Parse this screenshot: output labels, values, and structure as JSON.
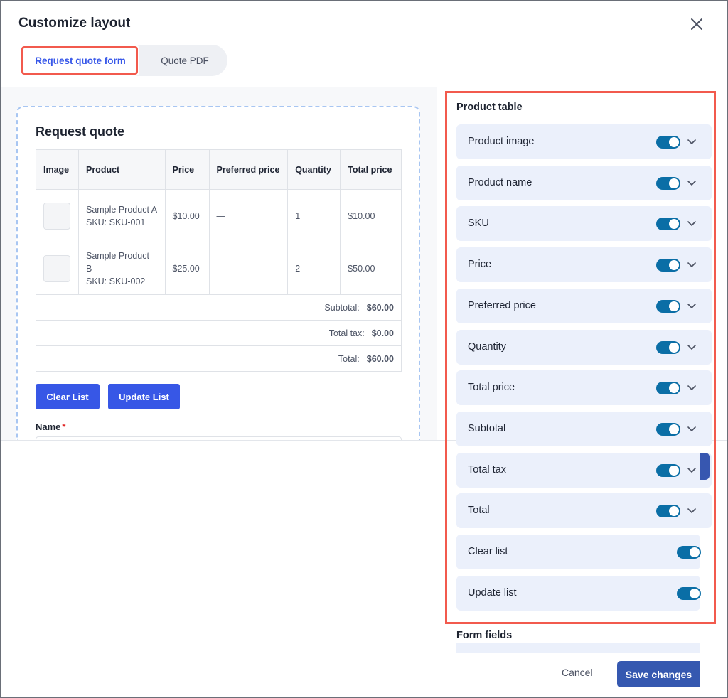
{
  "dialog": {
    "title": "Customize layout",
    "close_icon": "close-icon"
  },
  "tabs": [
    {
      "label": "Request quote form",
      "active": true
    },
    {
      "label": "Quote PDF",
      "active": false
    }
  ],
  "preview": {
    "title": "Request quote",
    "table": {
      "headers": [
        "Image",
        "Product",
        "Price",
        "Preferred price",
        "Quantity",
        "Total price"
      ],
      "rows": [
        {
          "name": "Sample Product A",
          "sku": "SKU: SKU-001",
          "price": "$10.00",
          "preferred": "—",
          "quantity": "1",
          "total": "$10.00"
        },
        {
          "name": "Sample Product B",
          "sku": "SKU: SKU-002",
          "price": "$25.00",
          "preferred": "—",
          "quantity": "2",
          "total": "$50.00"
        }
      ],
      "subtotal_label": "Subtotal:",
      "subtotal_value": "$60.00",
      "tax_label": "Total tax:",
      "tax_value": "$0.00",
      "total_label": "Total:",
      "total_value": "$60.00"
    },
    "buttons": {
      "clear": "Clear List",
      "update": "Update List"
    },
    "name_label": "Name",
    "required_marker": "*"
  },
  "settings": {
    "product_table_title": "Product table",
    "items": [
      {
        "label": "Product image",
        "enabled": true,
        "expandable": true
      },
      {
        "label": "Product name",
        "enabled": true,
        "expandable": true
      },
      {
        "label": "SKU",
        "enabled": true,
        "expandable": true
      },
      {
        "label": "Price",
        "enabled": true,
        "expandable": true
      },
      {
        "label": "Preferred price",
        "enabled": true,
        "expandable": true
      },
      {
        "label": "Quantity",
        "enabled": true,
        "expandable": true
      },
      {
        "label": "Total price",
        "enabled": true,
        "expandable": true
      },
      {
        "label": "Subtotal",
        "enabled": true,
        "expandable": true
      },
      {
        "label": "Total tax",
        "enabled": true,
        "expandable": true
      },
      {
        "label": "Total",
        "enabled": true,
        "expandable": true
      },
      {
        "label": "Clear list",
        "enabled": true,
        "expandable": false
      },
      {
        "label": "Update list",
        "enabled": true,
        "expandable": false
      }
    ],
    "form_fields_title": "Form fields"
  },
  "footer": {
    "cancel": "Cancel",
    "save": "Save changes"
  },
  "colors": {
    "accent": "#3757e6",
    "toggle_on": "#0a6ea6",
    "highlight": "#f25a4d",
    "row_bg": "#ebf0fb"
  }
}
